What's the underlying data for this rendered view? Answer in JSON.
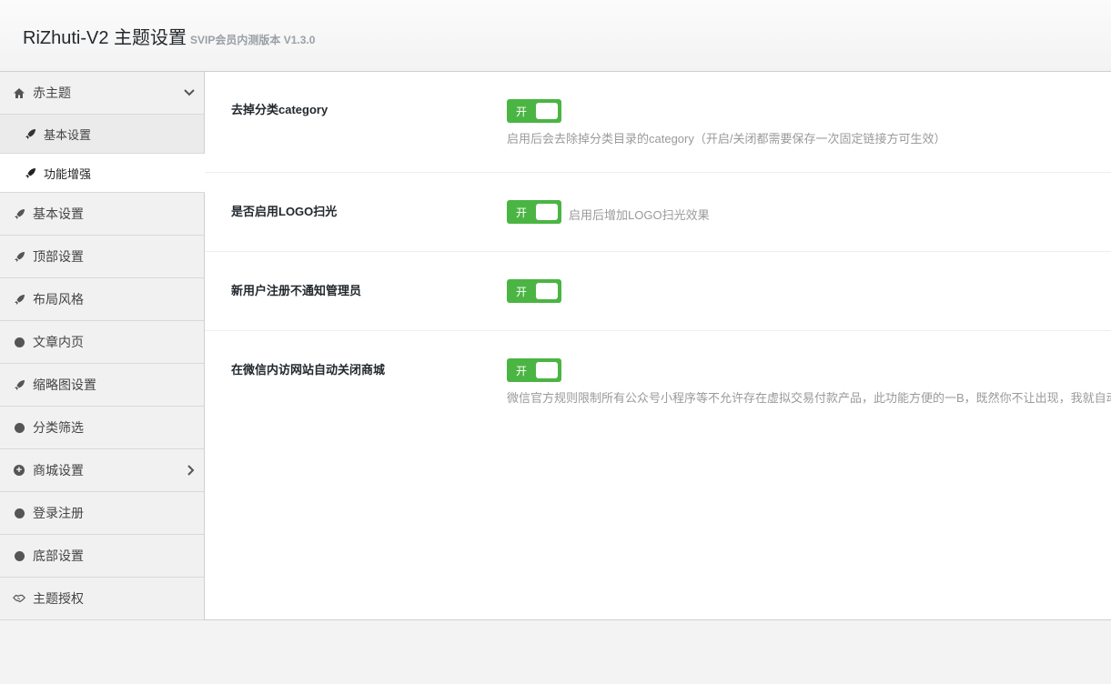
{
  "header": {
    "title": "RiZhuti-V2 主题设置",
    "version": "SVIP会员内测版本 V1.3.0"
  },
  "sidebar": {
    "group": {
      "label": "赤主题",
      "icon": "home-icon",
      "subitems": [
        {
          "label": "基本设置",
          "icon": "rocket-icon"
        },
        {
          "label": "功能增强",
          "icon": "rocket-icon",
          "active": true
        }
      ]
    },
    "items": [
      {
        "label": "基本设置",
        "icon": "rocket-icon"
      },
      {
        "label": "顶部设置",
        "icon": "rocket-icon"
      },
      {
        "label": "布局风格",
        "icon": "rocket-icon"
      },
      {
        "label": "文章内页",
        "icon": "circle-icon"
      },
      {
        "label": "缩略图设置",
        "icon": "rocket-icon"
      },
      {
        "label": "分类筛选",
        "icon": "circle-icon"
      },
      {
        "label": "商城设置",
        "icon": "plus-circle-icon"
      },
      {
        "label": "登录注册",
        "icon": "circle-icon"
      },
      {
        "label": "底部设置",
        "icon": "circle-icon"
      },
      {
        "label": "主题授权",
        "icon": "handshake-icon"
      }
    ]
  },
  "settings": [
    {
      "label": "去掉分类category",
      "toggle": "开",
      "enabled": true,
      "desc": "启用后会去除掉分类目录的category（开启/关闭都需要保存一次固定链接方可生效）"
    },
    {
      "label": "是否启用LOGO扫光",
      "toggle": "开",
      "enabled": true,
      "desc": "启用后增加LOGO扫光效果"
    },
    {
      "label": "新用户注册不通知管理员",
      "toggle": "开",
      "enabled": true,
      "desc": ""
    },
    {
      "label": "在微信内访网站自动关闭商城",
      "toggle": "开",
      "enabled": true,
      "desc": "微信官方规则限制所有公众号小程序等不允许存在虚拟交易付款产品，此功能方便的一B，既然你不让出现，我就自动"
    }
  ],
  "colors": {
    "accent": "#4bb543",
    "sidebar_bg": "#f1f1f1",
    "active_bg": "#ffffff"
  }
}
